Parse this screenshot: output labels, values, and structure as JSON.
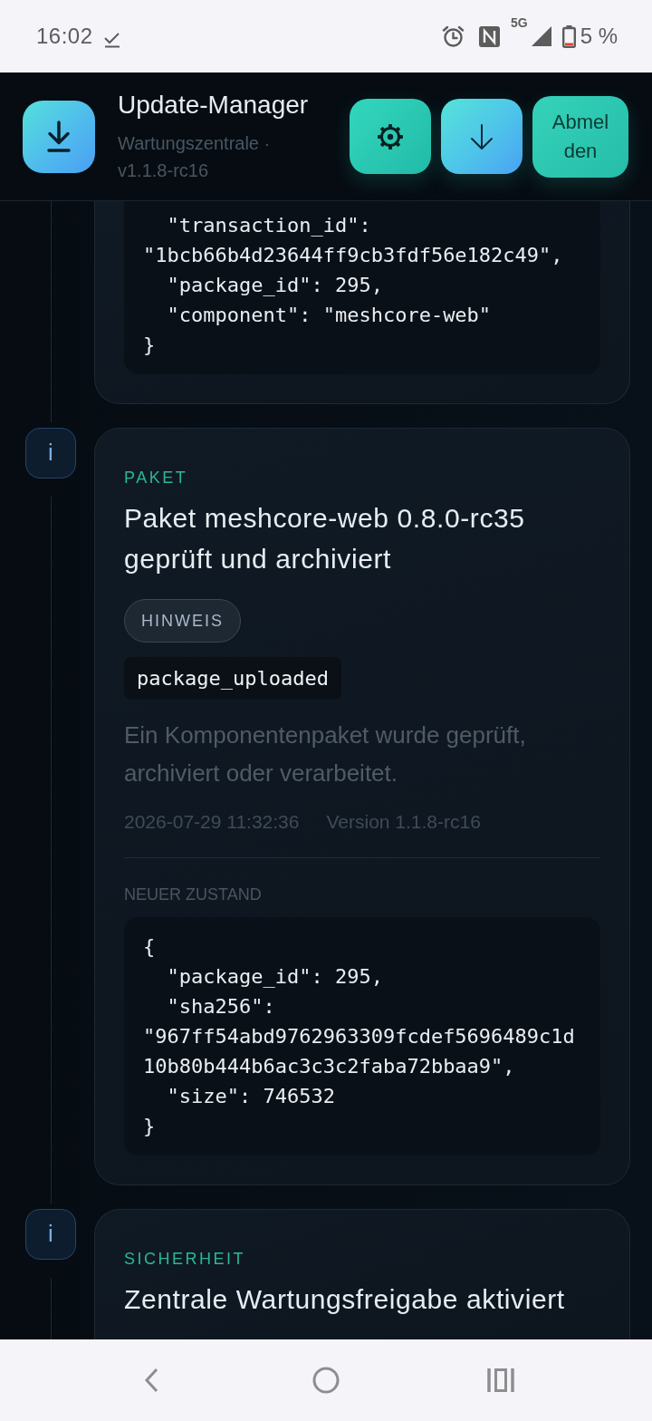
{
  "status_bar": {
    "time": "16:02",
    "network": "5G",
    "battery": "5 %"
  },
  "header": {
    "title": "Update-Manager",
    "subtitle": "Wartungszentrale · v1.1.8-rc16",
    "actions": [
      {
        "kind": "settings"
      },
      {
        "kind": "download"
      },
      {
        "kind": "text",
        "label": "Abmelden"
      }
    ]
  },
  "timeline": [
    {
      "code": [
        "  \"transaction_id\":",
        "\"1bcb66b4d23644ff9cb3fdf56e182c49\",",
        "  \"package_id\": 295,",
        "  \"component\": \"meshcore-web\"",
        "}"
      ]
    },
    {
      "marker": "i",
      "category": "PAKET",
      "title": "Paket meshcore-web 0.8.0-rc35 geprüft und archiviert",
      "badge": "HINWEIS",
      "event_code": "package_uploaded",
      "description": "Ein Komponentenpaket wurde geprüft, archiviert oder verarbeitet.",
      "timestamp": "2026-07-29 11:32:36",
      "version": "Version 1.1.8-rc16",
      "section_label": "NEUER ZUSTAND",
      "code": [
        "{",
        "  \"package_id\": 295,",
        "  \"sha256\":",
        "\"967ff54abd9762963309fcdef5696489c1d",
        "10b80b444b6ac3c3c2faba72bbaa9\",",
        "  \"size\": 746532",
        "}"
      ]
    },
    {
      "marker": "i",
      "category": "SICHERHEIT",
      "title": "Zentrale Wartungsfreigabe aktiviert"
    }
  ]
}
